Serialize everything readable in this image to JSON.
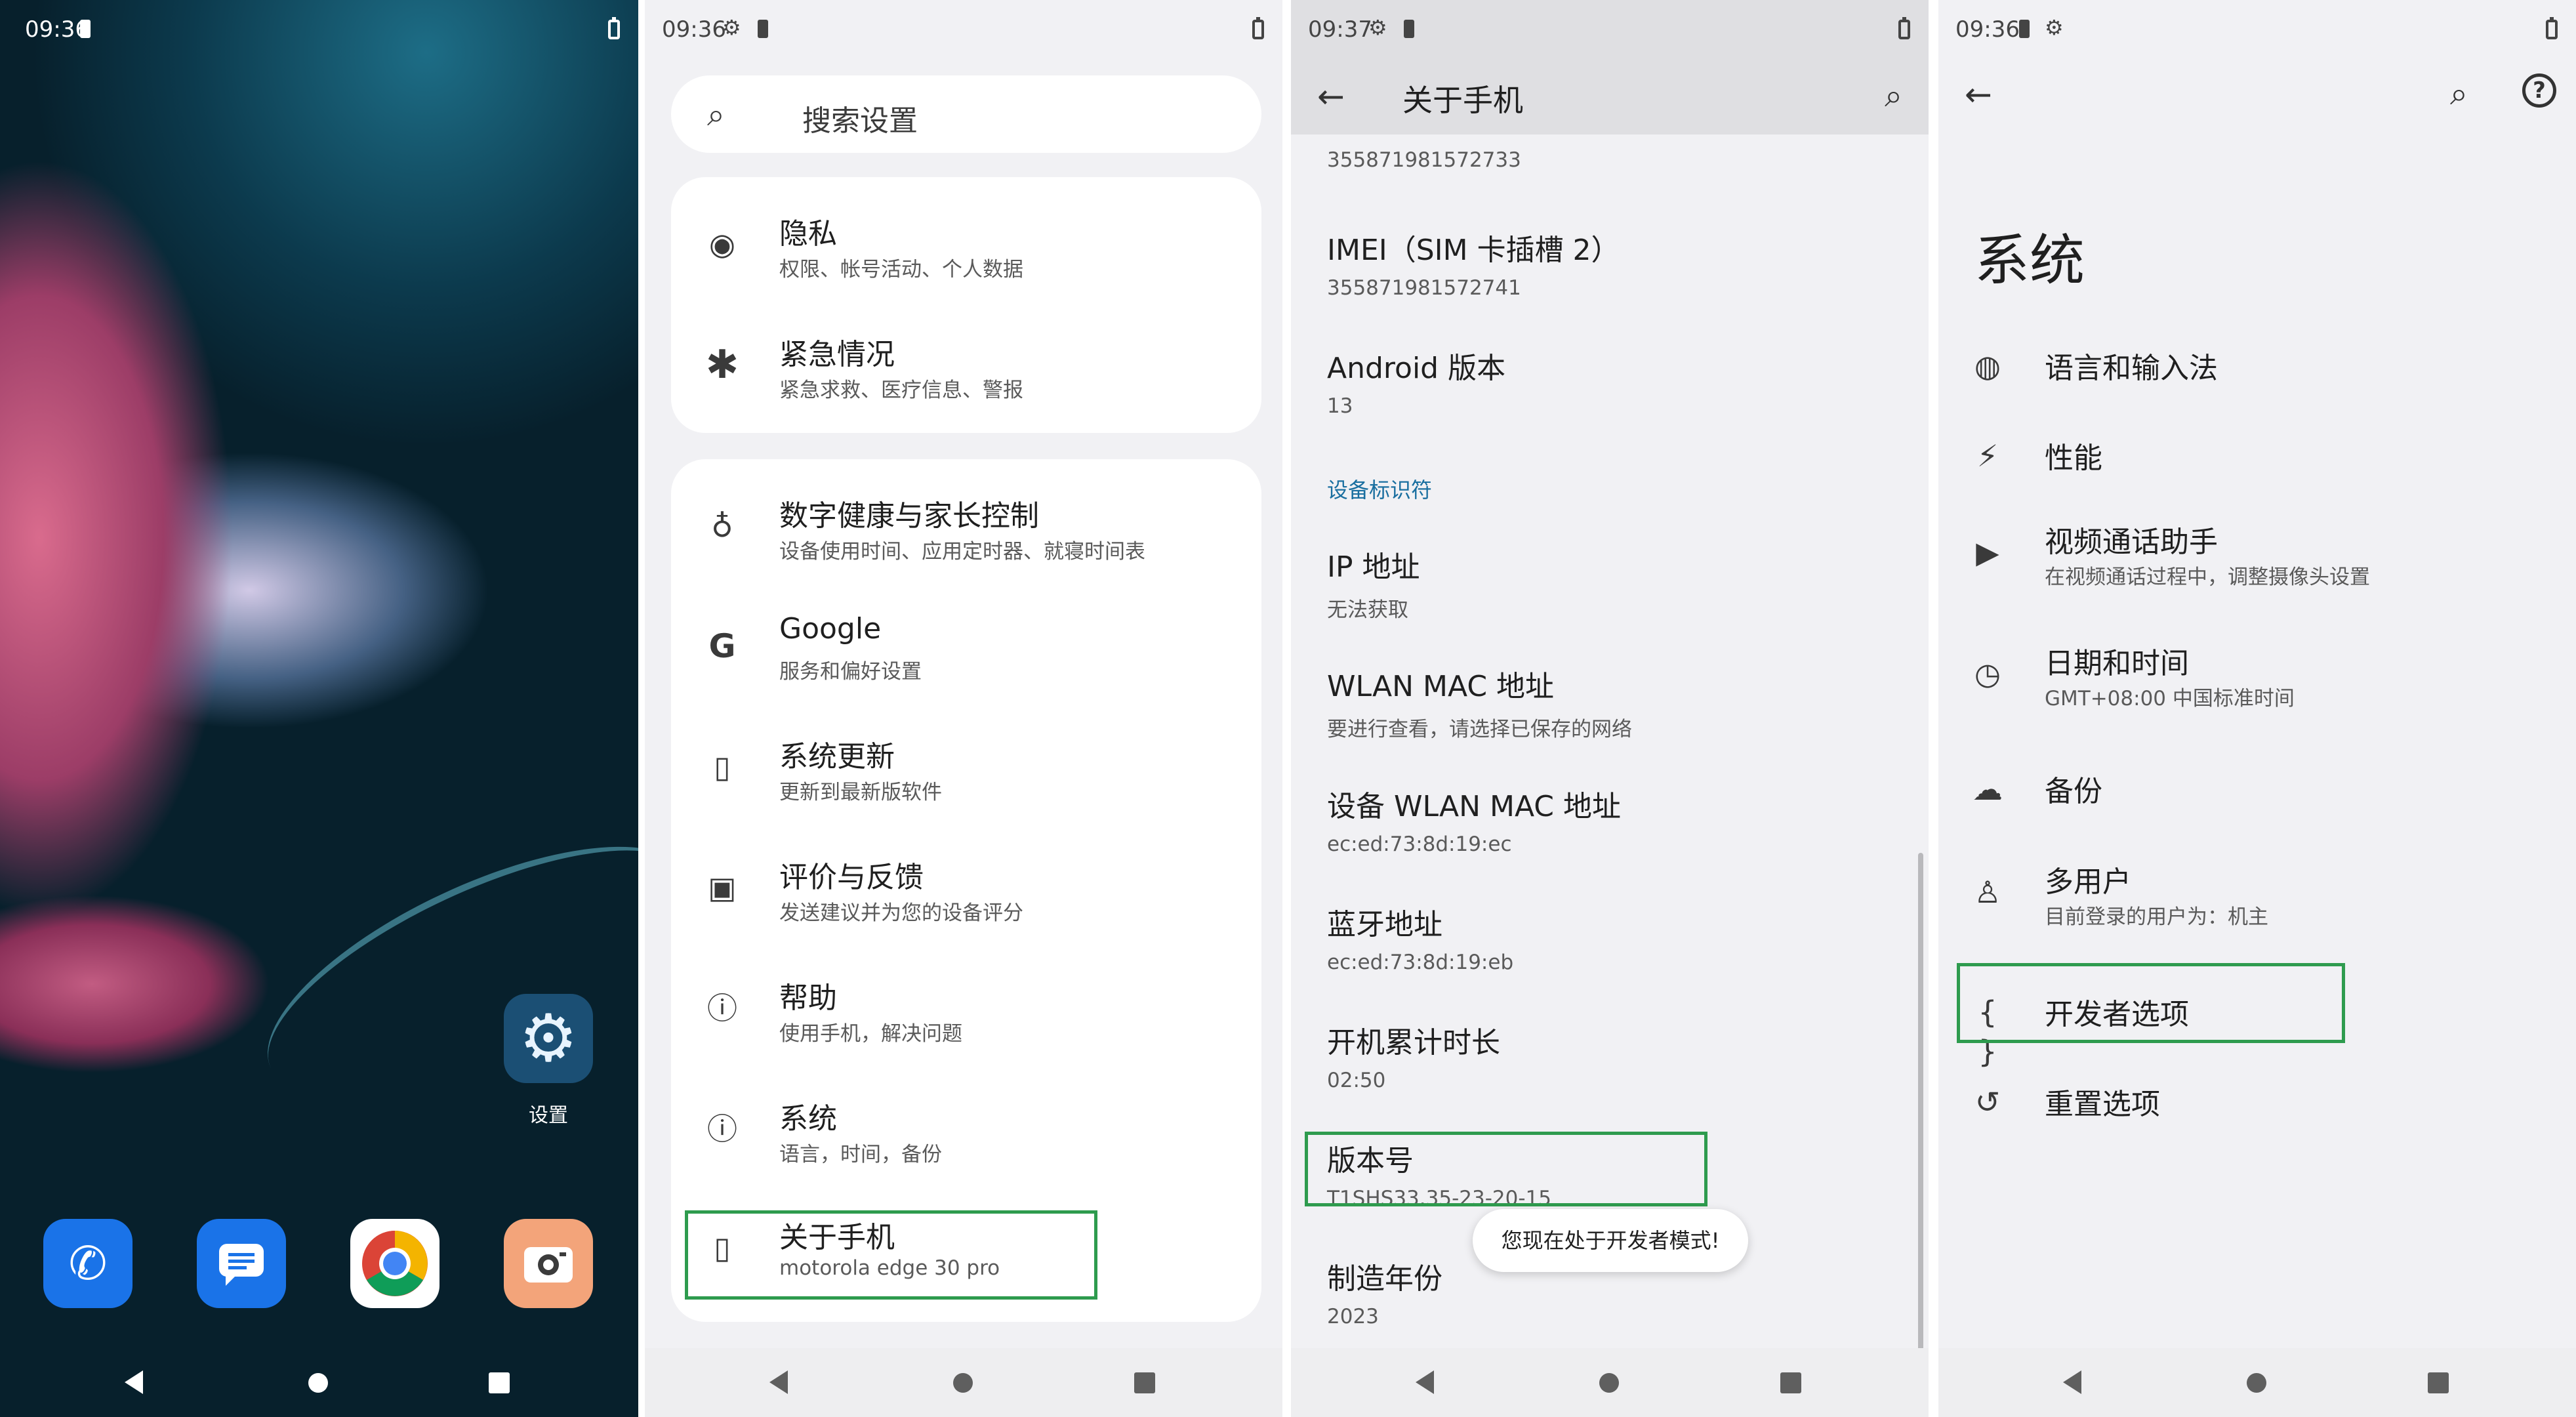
{
  "panel1": {
    "status_time": "09:36",
    "settings_app_label": "设置",
    "dock_apps": [
      "phone-app",
      "messages-app",
      "chrome-app",
      "camera-app"
    ]
  },
  "panel2": {
    "status_time": "09:36",
    "search_placeholder": "搜索设置",
    "card1": [
      {
        "title": "隐私",
        "subtitle": "权限、帐号活动、个人数据",
        "icon": "privacy-eye-icon"
      },
      {
        "title": "紧急情况",
        "subtitle": "紧急求救、医疗信息、警报",
        "icon": "emergency-asterisk-icon"
      }
    ],
    "card2": [
      {
        "title": "数字健康与家长控制",
        "subtitle": "设备使用时间、应用定时器、就寝时间表",
        "icon": "wellbeing-icon"
      },
      {
        "title": "Google",
        "subtitle": "服务和偏好设置",
        "icon": "google-icon"
      },
      {
        "title": "系统更新",
        "subtitle": "更新到最新版软件",
        "icon": "system-update-icon"
      },
      {
        "title": "评价与反馈",
        "subtitle": "发送建议并为您的设备评分",
        "icon": "feedback-icon"
      },
      {
        "title": "帮助",
        "subtitle": "使用手机，解决问题",
        "icon": "help-icon"
      },
      {
        "title": "系统",
        "subtitle": "语言，时间，备份",
        "icon": "info-icon"
      },
      {
        "title": "关于手机",
        "subtitle": "motorola edge 30 pro",
        "icon": "phone-icon"
      }
    ]
  },
  "panel3": {
    "status_time": "09:37",
    "title": "关于手机",
    "partial_value": "355871981572733",
    "items": [
      {
        "title": "IMEI（SIM 卡插槽 2）",
        "value": "355871981572741"
      },
      {
        "title": "Android 版本",
        "value": "13"
      }
    ],
    "section_header": "设备标识符",
    "items2": [
      {
        "title": "IP 地址",
        "value": "无法获取"
      },
      {
        "title": "WLAN MAC 地址",
        "value": "要进行查看，请选择已保存的网络"
      },
      {
        "title": "设备 WLAN MAC 地址",
        "value": "ec:ed:73:8d:19:ec"
      },
      {
        "title": "蓝牙地址",
        "value": "ec:ed:73:8d:19:eb"
      },
      {
        "title": "开机累计时长",
        "value": "02:50"
      },
      {
        "title": "版本号",
        "value": "T1SHS33.35-23-20-15"
      },
      {
        "title": "制造年份",
        "value": "2023"
      }
    ],
    "toast": "您现在处于开发者模式!"
  },
  "panel4": {
    "status_time": "09:36",
    "title": "系统",
    "items": [
      {
        "title": "语言和输入法",
        "subtitle": "",
        "icon": "globe-icon"
      },
      {
        "title": "性能",
        "subtitle": "",
        "icon": "performance-icon"
      },
      {
        "title": "视频通话助手",
        "subtitle": "在视频通话过程中，调整摄像头设置",
        "icon": "video-camera-icon"
      },
      {
        "title": "日期和时间",
        "subtitle": "GMT+08:00 中国标准时间",
        "icon": "clock-icon"
      },
      {
        "title": "备份",
        "subtitle": "",
        "icon": "cloud-backup-icon"
      },
      {
        "title": "多用户",
        "subtitle": "目前登录的用户为：机主",
        "icon": "user-icon"
      },
      {
        "title": "开发者选项",
        "subtitle": "",
        "icon": "braces-icon"
      },
      {
        "title": "重置选项",
        "subtitle": "",
        "icon": "reset-history-icon"
      }
    ]
  },
  "colors": {
    "highlight": "#2e9b4e",
    "section_header": "#1a6fa0",
    "panel_bg": "#f1f1f4",
    "card_bg": "#ffffff"
  }
}
